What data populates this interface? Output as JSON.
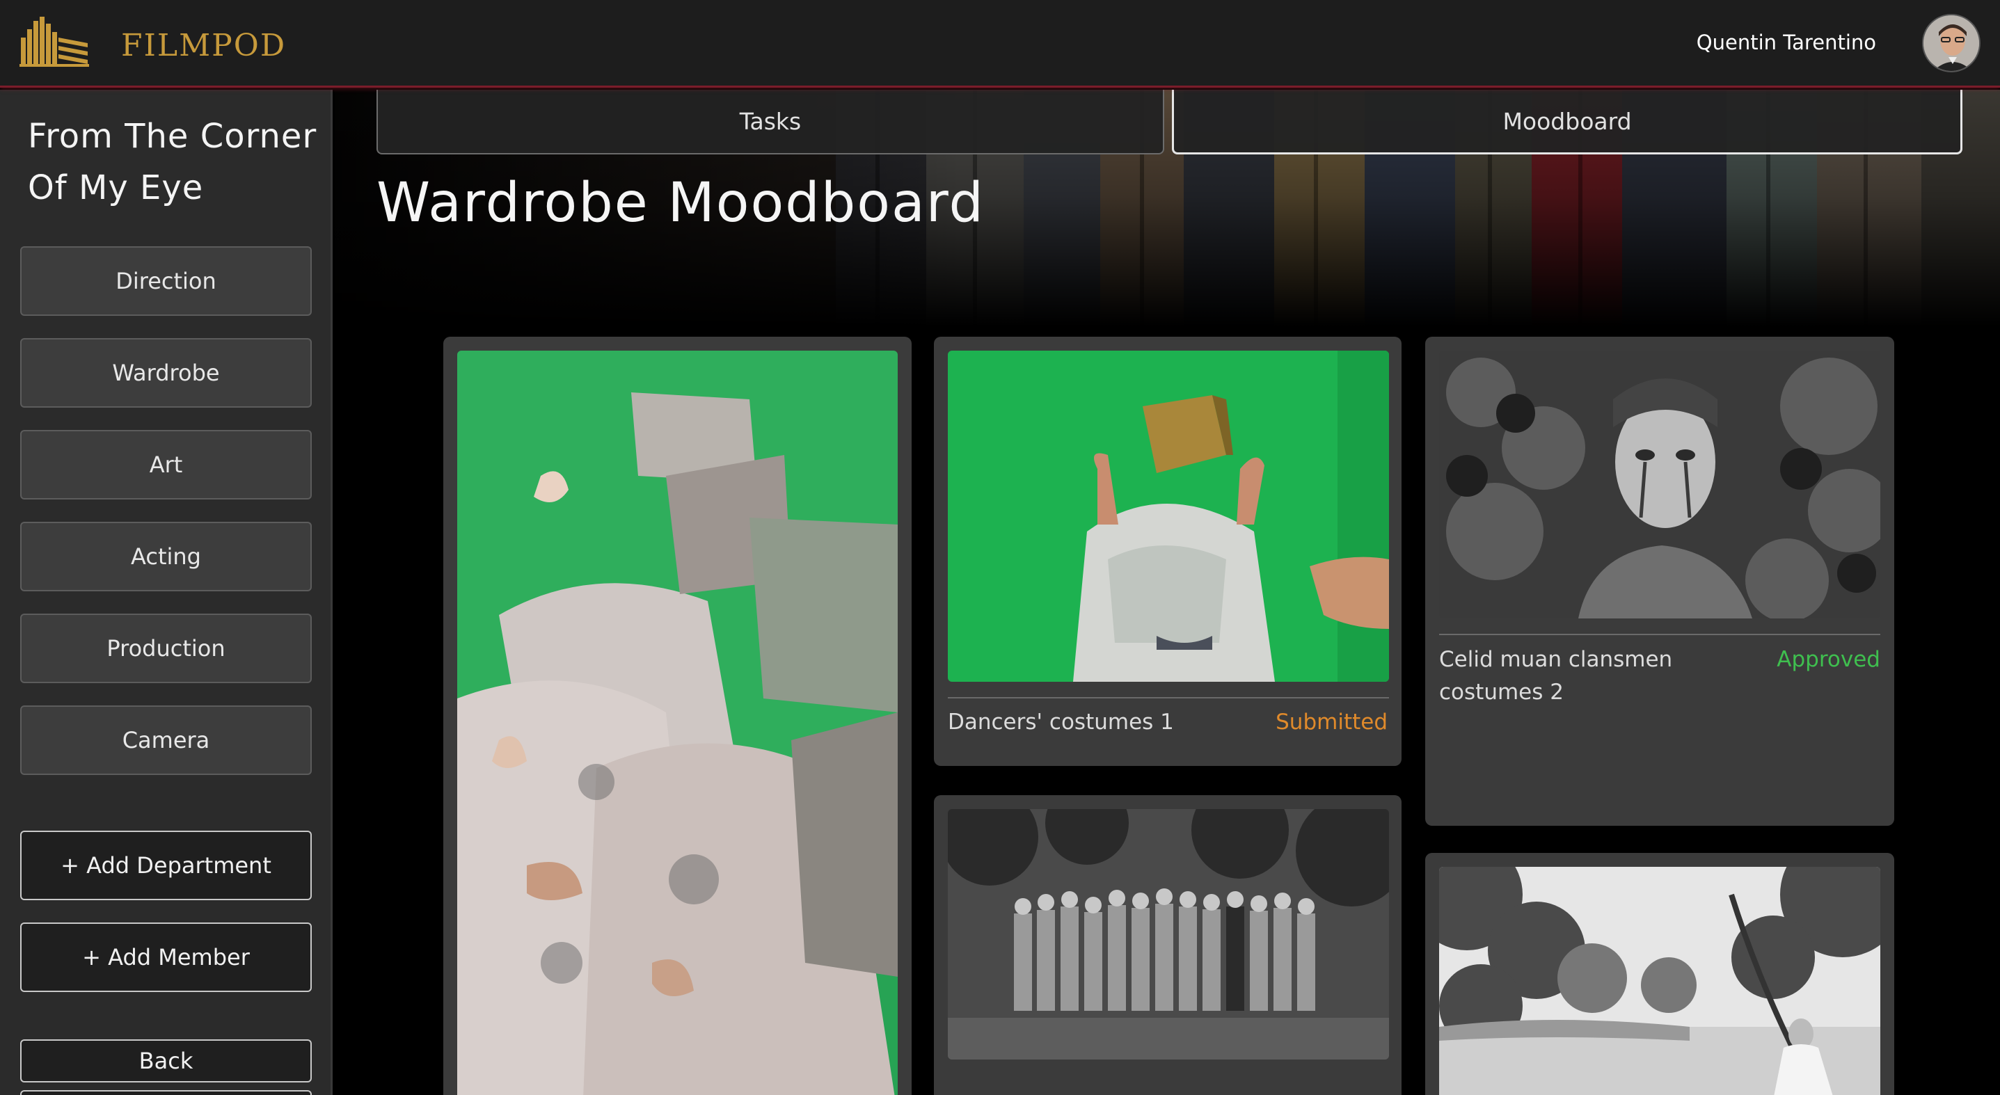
{
  "header": {
    "brand": "FILMPOD",
    "user_name": "Quentin Tarentino"
  },
  "sidebar": {
    "project_title": "From The Corner Of My Eye",
    "departments": [
      "Direction",
      "Wardrobe",
      "Art",
      "Acting",
      "Production",
      "Camera"
    ],
    "add_department_label": "+ Add Department",
    "add_member_label": "+ Add Member",
    "back_label": "Back"
  },
  "main": {
    "tabs": [
      {
        "label": "Tasks",
        "active": false
      },
      {
        "label": "Moodboard",
        "active": true
      }
    ],
    "page_title": "Wardrobe Moodboard",
    "cards": [
      {
        "caption": "",
        "status": ""
      },
      {
        "caption": "Dancers' costumes 1",
        "status": "Submitted"
      },
      {
        "caption": "Celid muan clansmen costumes 2",
        "status": "Approved"
      },
      {
        "caption": "",
        "status": ""
      },
      {
        "caption": "",
        "status": ""
      }
    ]
  },
  "colors": {
    "accent_gold": "#c79a3b",
    "status_submitted": "#e08a2b",
    "status_approved": "#3fbf4f",
    "topbar_border": "#7a1c2a"
  },
  "icons": {
    "logo": "building-columns-logo-icon",
    "avatar": "user-avatar-icon"
  }
}
